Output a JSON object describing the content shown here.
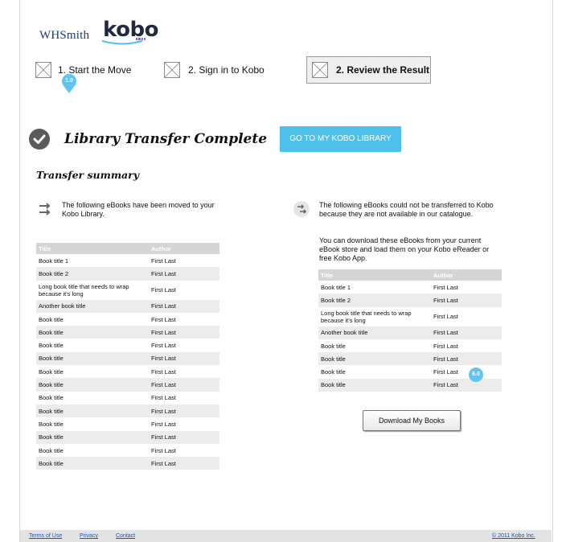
{
  "header": {
    "whsmith_logo": "WHSmith",
    "kobo_logo": "kobo",
    "kobo_dot_colors": [
      "#c94aa7",
      "#5b6fd1",
      "#8f66c9",
      "#e24a9b"
    ]
  },
  "steps": [
    {
      "label": "1. Start the Move",
      "icon": "image-placeholder-icon"
    },
    {
      "label": "2. Sign in to Kobo",
      "icon": "image-placeholder-icon"
    },
    {
      "label": "2. Review the Result",
      "icon": "image-placeholder-icon",
      "active": true
    }
  ],
  "markers": {
    "step_marker": "1.0",
    "table_marker": "6.0"
  },
  "main": {
    "heading": "Library Transfer Complete",
    "cta_label": "GO TO MY KOBO LIBRARY",
    "summary_heading": "Transfer summary"
  },
  "moved": {
    "description": "The following eBooks have been moved to your Kobo Library.",
    "icon": "transfer-arrows-icon",
    "columns": [
      "Title",
      "Author"
    ],
    "rows": [
      [
        "Book title 1",
        "First Last"
      ],
      [
        "Book title 2",
        "First Last"
      ],
      [
        "Long book title that needs to wrap because it's long",
        "First Last"
      ],
      [
        "Another book title",
        "First Last"
      ],
      [
        "Book title",
        "First Last"
      ],
      [
        "Book title",
        "First Last"
      ],
      [
        "Book title",
        "First Last"
      ],
      [
        "Book title",
        "First Last"
      ],
      [
        "Book title",
        "First Last"
      ],
      [
        "Book title",
        "First Last"
      ],
      [
        "Book title",
        "First Last"
      ],
      [
        "Book title",
        "First Last"
      ],
      [
        "Book title",
        "First Last"
      ],
      [
        "Book title",
        "First Last"
      ],
      [
        "Book title",
        "First Last"
      ],
      [
        "Book title",
        "First Last"
      ]
    ]
  },
  "not_moved": {
    "description": "The following eBooks  could not be transferred to Kobo because they are not available in our catalogue.",
    "download_note": "You can download these eBooks from your current eBook store and load them on your Kobo eReader or free Kobo App.",
    "icon": "transfer-failed-icon",
    "columns": [
      "Title",
      "Author"
    ],
    "rows": [
      [
        "Book title 1",
        "First Last"
      ],
      [
        "Book title 2",
        "First Last"
      ],
      [
        "Long book title that needs to wrap because it's long",
        "First Last"
      ],
      [
        "Another book title",
        "First Last"
      ],
      [
        "Book title",
        "First Last"
      ],
      [
        "Book title",
        "First Last"
      ],
      [
        "Book title",
        "First Last"
      ],
      [
        "Book title",
        "First Last"
      ]
    ],
    "download_button": "Download My Books"
  },
  "footer": {
    "links": [
      "Terms of Use",
      "Privacy",
      "Contact"
    ],
    "copyright": "© 2011 Kobo Inc."
  },
  "colors": {
    "accent": "#4ec0ec",
    "marker": "#60c3f0",
    "table_header": "#d5d5d5",
    "row_alt": "#ececec"
  }
}
